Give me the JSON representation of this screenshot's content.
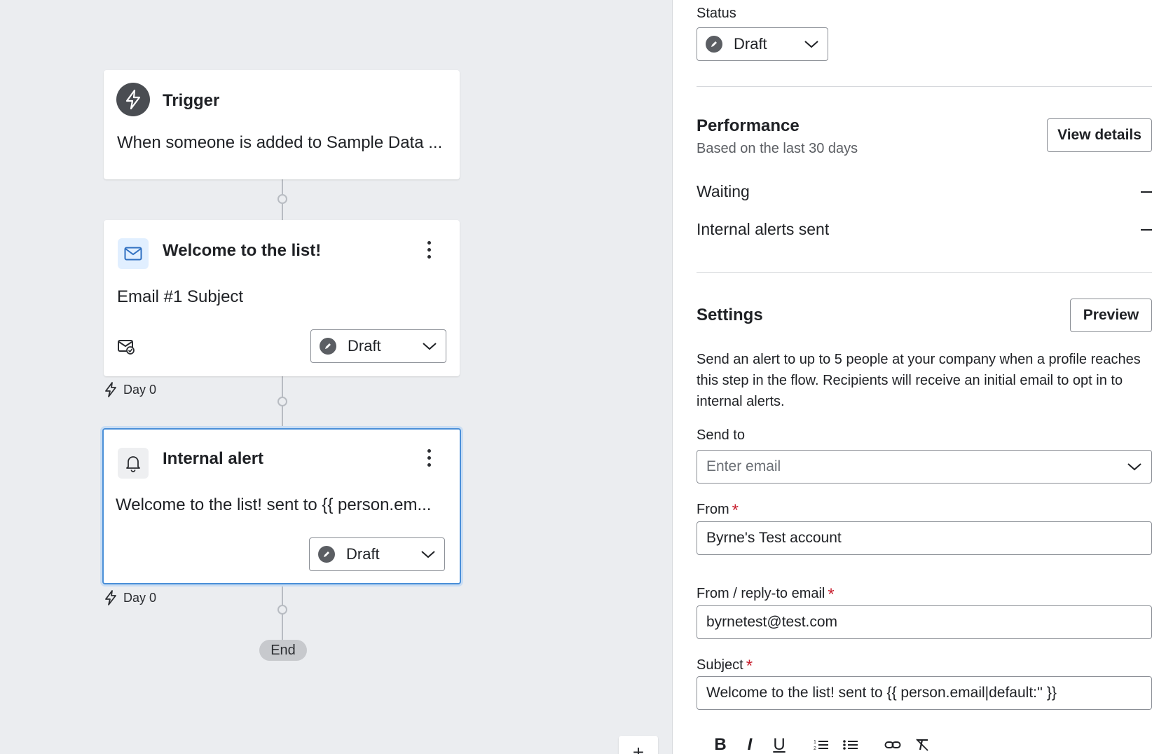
{
  "canvas": {
    "trigger": {
      "title": "Trigger",
      "description": "When someone is added to Sample Data ..."
    },
    "email_step": {
      "title": "Welcome to the list!",
      "subject": "Email #1 Subject",
      "status": "Draft",
      "delay": "Day 0"
    },
    "alert_step": {
      "title": "Internal alert",
      "description": "Welcome to the list! sent to {{ person.em...",
      "status": "Draft",
      "delay": "Day 0"
    },
    "end_label": "End",
    "zoom_in_label": "+"
  },
  "panel": {
    "status": {
      "label": "Status",
      "value": "Draft"
    },
    "performance": {
      "heading": "Performance",
      "subtitle": "Based on the last 30 days",
      "view_details_label": "View details",
      "metrics": [
        {
          "label": "Waiting",
          "value": "–"
        },
        {
          "label": "Internal alerts sent",
          "value": "–"
        }
      ]
    },
    "settings": {
      "heading": "Settings",
      "preview_label": "Preview",
      "description": "Send an alert to up to 5 people at your company when a profile reaches this step in the flow. Recipients will receive an initial email to opt in to internal alerts.",
      "send_to": {
        "label": "Send to",
        "placeholder": "Enter email"
      },
      "from": {
        "label": "From",
        "value": "Byrne's Test account"
      },
      "reply_to": {
        "label": "From / reply-to email",
        "value": "byrnetest@test.com"
      },
      "subject": {
        "label": "Subject",
        "value": "Welcome to the list! sent to {{ person.email|default:'' }}"
      },
      "required_marker": "*"
    },
    "editor_toolbar": [
      "B",
      "I",
      "U"
    ]
  },
  "colors": {
    "accent_selected": "#4a8fd8",
    "required": "#c8202f",
    "canvas_bg": "#ebedf0"
  }
}
